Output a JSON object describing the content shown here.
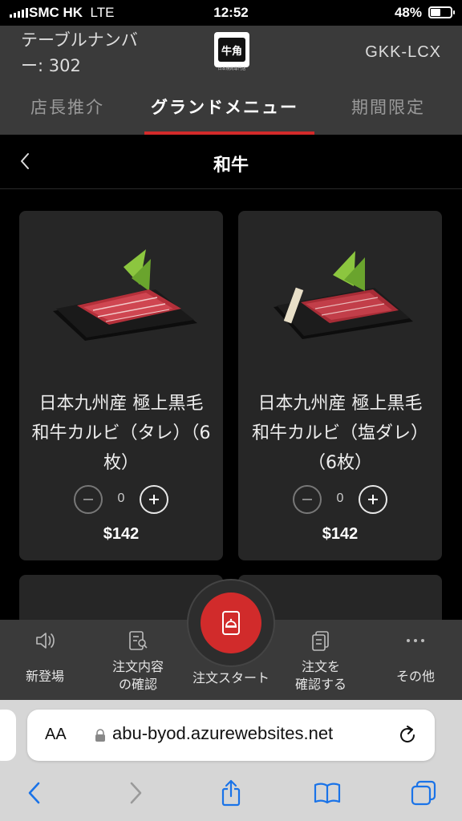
{
  "status_bar": {
    "carrier": "SMC HK",
    "network": "LTE",
    "time": "12:52",
    "battery_percent_label": "48%",
    "battery_level": 0.48
  },
  "header": {
    "table_number": "テーブルナンバー: 302",
    "logo_text": "牛角",
    "logo_subtext": "日本焼肉専門店",
    "store_code": "GKK-LCX"
  },
  "tabs": [
    {
      "label": "店長推介",
      "active": false
    },
    {
      "label": "グランドメニュー",
      "active": true
    },
    {
      "label": "期間限定",
      "active": false
    }
  ],
  "category": {
    "title": "和牛"
  },
  "items": [
    {
      "name": "日本九州産 極上黒毛和牛カルビ（タレ）（6枚）",
      "quantity": "0",
      "price": "$142"
    },
    {
      "name": "日本九州産 極上黒毛和牛カルビ（塩ダレ）（6枚）",
      "quantity": "0",
      "price": "$142"
    }
  ],
  "bottom_nav": {
    "new_label": "新登場",
    "order_check_label": "注文内容\nの確認",
    "start_label": "注文スタート",
    "confirm_label": "注文を\n確認する",
    "more_label": "その他"
  },
  "browser": {
    "aa_label": "AA",
    "url": "abu-byod.azurewebsites.net"
  },
  "colors": {
    "accent": "#d12b2b",
    "header_bg": "#3a3a3a",
    "card_bg": "#262626"
  }
}
